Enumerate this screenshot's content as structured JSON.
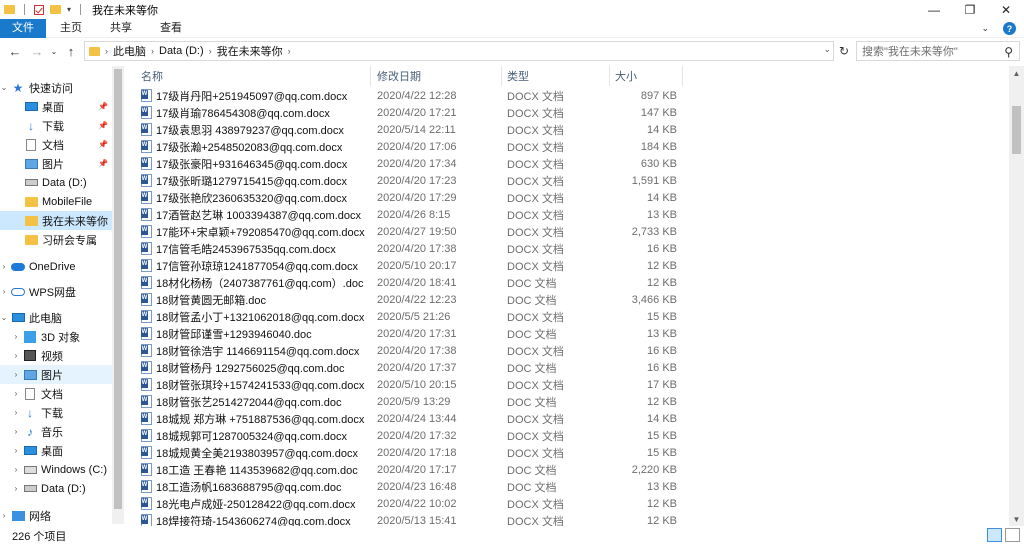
{
  "window": {
    "title": "我在未来等你",
    "minimize_glyph": "—",
    "maximize_glyph": "❐",
    "close_glyph": "✕"
  },
  "ribbon": {
    "tabs": [
      "文件",
      "主页",
      "共享",
      "查看"
    ]
  },
  "address": {
    "crumbs": [
      "此电脑",
      "Data (D:)",
      "我在未来等你"
    ],
    "search_placeholder": "搜索\"我在未来等你\""
  },
  "sidebar": {
    "quick_access": "快速访问",
    "quick_items": [
      {
        "label": "桌面",
        "icon": "desktop-icon",
        "pinned": true
      },
      {
        "label": "下载",
        "icon": "download-icon",
        "pinned": true
      },
      {
        "label": "文档",
        "icon": "document-icon",
        "pinned": true
      },
      {
        "label": "图片",
        "icon": "picture-icon",
        "pinned": true
      },
      {
        "label": "Data (D:)",
        "icon": "drive-icon",
        "pinned": false
      },
      {
        "label": "MobileFile",
        "icon": "folder-icon",
        "pinned": false
      },
      {
        "label": "我在未来等你",
        "icon": "folder-icon",
        "pinned": false
      },
      {
        "label": "习研会专属",
        "icon": "folder-icon",
        "pinned": false
      }
    ],
    "onedrive": "OneDrive",
    "wps": "WPS网盘",
    "this_pc": "此电脑",
    "pc_items": [
      {
        "label": "3D 对象",
        "icon": "3d-objects-icon"
      },
      {
        "label": "视频",
        "icon": "video-icon"
      },
      {
        "label": "图片",
        "icon": "picture-icon"
      },
      {
        "label": "文档",
        "icon": "document-icon"
      },
      {
        "label": "下载",
        "icon": "download-icon"
      },
      {
        "label": "音乐",
        "icon": "music-icon"
      },
      {
        "label": "桌面",
        "icon": "desktop-icon"
      },
      {
        "label": "Windows (C:)",
        "icon": "windows-drive-icon"
      },
      {
        "label": "Data (D:)",
        "icon": "drive-icon"
      }
    ],
    "network": "网络"
  },
  "columns": {
    "name": "名称",
    "date": "修改日期",
    "type": "类型",
    "size": "大小"
  },
  "files": [
    {
      "name": "17级肖丹阳+251945097@qq.com.docx",
      "date": "2020/4/22 12:28",
      "type": "DOCX 文档",
      "size": "897 KB"
    },
    {
      "name": "17级肖瑜786454308@qq.com.docx",
      "date": "2020/4/20 17:21",
      "type": "DOCX 文档",
      "size": "147 KB"
    },
    {
      "name": "17级袁思羽 438979237@qq.com.docx",
      "date": "2020/5/14 22:11",
      "type": "DOCX 文档",
      "size": "14 KB"
    },
    {
      "name": "17级张瀚+2548502083@qq.com.docx",
      "date": "2020/4/20 17:06",
      "type": "DOCX 文档",
      "size": "184 KB"
    },
    {
      "name": "17级张豪阳+931646345@qq.com.docx",
      "date": "2020/4/20 17:34",
      "type": "DOCX 文档",
      "size": "630 KB"
    },
    {
      "name": "17级张昕璐1279715415@qq.com.docx",
      "date": "2020/4/20 17:23",
      "type": "DOCX 文档",
      "size": "1,591 KB"
    },
    {
      "name": "17级张艳欣2360635320@qq.com.docx",
      "date": "2020/4/20 17:29",
      "type": "DOCX 文档",
      "size": "14 KB"
    },
    {
      "name": "17酒管赵艺琳 1003394387@qq.com.docx",
      "date": "2020/4/26 8:15",
      "type": "DOCX 文档",
      "size": "13 KB"
    },
    {
      "name": "17能环+宋卓颖+792085470@qq.com.docx",
      "date": "2020/4/27 19:50",
      "type": "DOCX 文档",
      "size": "2,733 KB"
    },
    {
      "name": "17信管毛皓2453967535qq.com.docx",
      "date": "2020/4/20 17:38",
      "type": "DOCX 文档",
      "size": "16 KB"
    },
    {
      "name": "17信管孙琼琼1241877054@qq.com.docx",
      "date": "2020/5/10 20:17",
      "type": "DOCX 文档",
      "size": "12 KB"
    },
    {
      "name": "18材化杨杨（2407387761@qq.com）.doc",
      "date": "2020/4/20 18:41",
      "type": "DOC 文档",
      "size": "12 KB"
    },
    {
      "name": "18财管黄圆无邮箱.doc",
      "date": "2020/4/22 12:23",
      "type": "DOC 文档",
      "size": "3,466 KB"
    },
    {
      "name": "18财管孟小丁+1321062018@qq.com.docx",
      "date": "2020/5/5 21:26",
      "type": "DOCX 文档",
      "size": "15 KB"
    },
    {
      "name": "18财管邱谨雪+1293946040.doc",
      "date": "2020/4/20 17:31",
      "type": "DOC 文档",
      "size": "13 KB"
    },
    {
      "name": "18财管徐浩宇 1146691154@qq.com.docx",
      "date": "2020/4/20 17:38",
      "type": "DOCX 文档",
      "size": "16 KB"
    },
    {
      "name": "18财管杨丹 1292756025@qq.com.doc",
      "date": "2020/4/20 17:37",
      "type": "DOC 文档",
      "size": "16 KB"
    },
    {
      "name": "18财管张琪玲+1574241533@qq.com.docx",
      "date": "2020/5/10 20:15",
      "type": "DOCX 文档",
      "size": "17 KB"
    },
    {
      "name": "18财管张艺2514272044@qq.com.doc",
      "date": "2020/5/9 13:29",
      "type": "DOC 文档",
      "size": "12 KB"
    },
    {
      "name": "18城规 郑方琳 +751887536@qq.com.docx",
      "date": "2020/4/24 13:44",
      "type": "DOCX 文档",
      "size": "14 KB"
    },
    {
      "name": "18城规郭可1287005324@qq.com.docx",
      "date": "2020/4/20 17:32",
      "type": "DOCX 文档",
      "size": "15 KB"
    },
    {
      "name": "18城规黄全美2193803957@qq.com.docx",
      "date": "2020/4/20 17:18",
      "type": "DOCX 文档",
      "size": "15 KB"
    },
    {
      "name": "18工造 王春艳 1143539682@qq.com.doc",
      "date": "2020/4/20 17:17",
      "type": "DOC 文档",
      "size": "2,220 KB"
    },
    {
      "name": "18工造汤帆1683688795@qq.com.doc",
      "date": "2020/4/23 16:48",
      "type": "DOC 文档",
      "size": "13 KB"
    },
    {
      "name": "18光电卢成娅-250128422@qq.com.docx",
      "date": "2020/4/22 10:02",
      "type": "DOCX 文档",
      "size": "12 KB"
    },
    {
      "name": "18焊接符琦-1543606274@qq.com.docx",
      "date": "2020/5/13 15:41",
      "type": "DOCX 文档",
      "size": "12 KB"
    }
  ],
  "status": {
    "count": "226 个项目"
  }
}
